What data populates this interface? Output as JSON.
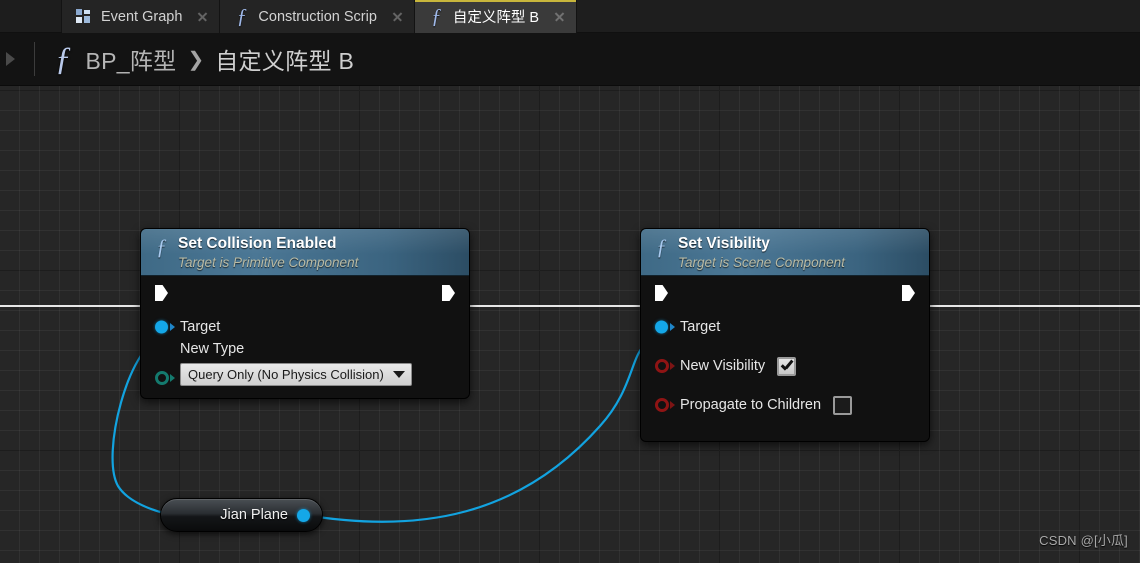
{
  "tabbar": {
    "tabs": [
      {
        "label": "Event Graph",
        "icon": "grid-icon",
        "active": false,
        "closable": true
      },
      {
        "label": "Construction Scrip",
        "icon": "function-fx-icon",
        "active": false,
        "closable": true
      },
      {
        "label": "自定义阵型 B",
        "icon": "function-fx-icon",
        "active": true,
        "closable": true
      }
    ]
  },
  "breadcrumb": {
    "back_icon": "back-arrow-icon",
    "fx_icon": "function-fx-icon",
    "root": "BP_阵型",
    "separator": "❯",
    "current": "自定义阵型 B"
  },
  "graph": {
    "nodes": [
      {
        "id": "set-collision-enabled",
        "title": "Set Collision Enabled",
        "subtitle": "Target is Primitive Component",
        "exec_in": "exec-in-pin",
        "exec_out": "exec-out-pin",
        "pins": [
          {
            "name": "Target",
            "type": "object"
          }
        ],
        "property": {
          "label": "New Type",
          "pin_type": "enum",
          "combo_value": "Query Only (No Physics Collision)"
        }
      },
      {
        "id": "set-visibility",
        "title": "Set Visibility",
        "subtitle": "Target is Scene Component",
        "exec_in": "exec-in-pin",
        "exec_out": "exec-out-pin",
        "pins": [
          {
            "name": "Target",
            "type": "object"
          },
          {
            "name": "New Visibility",
            "type": "bool",
            "checked": true
          },
          {
            "name": "Propagate to Children",
            "type": "bool",
            "checked": false
          }
        ]
      }
    ],
    "variable_node": {
      "label": "Jian Plane",
      "pin_type": "object"
    }
  },
  "watermark": "CSDN @[小瓜]",
  "colors": {
    "accent_tab": "#c8b63c",
    "node_header": "#3f6a86",
    "object_pin": "#14a7e8",
    "bool_pin": "#8f1414",
    "wire_data": "#12a3e0",
    "wire_exec": "#ffffff",
    "canvas": "#262626"
  }
}
